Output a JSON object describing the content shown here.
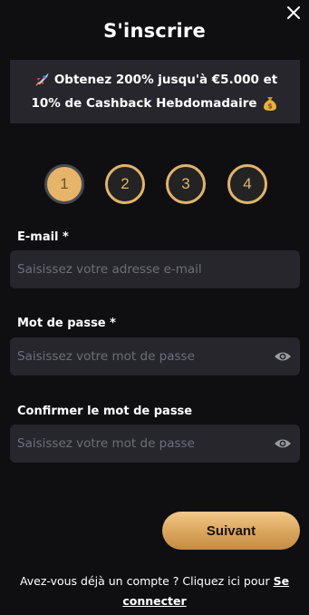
{
  "modal": {
    "title": "S'inscrire",
    "close_icon": "close-icon"
  },
  "promo": {
    "line1": "Obtenez 200% jusqu'à €5.000 et",
    "line2": "10% de Cashback Hebdomadaire",
    "line1_icon": "rocket-icon",
    "line2_icon": "money-bag-icon"
  },
  "steps": [
    {
      "label": "1",
      "active": true
    },
    {
      "label": "2",
      "active": false
    },
    {
      "label": "3",
      "active": false
    },
    {
      "label": "4",
      "active": false
    }
  ],
  "form": {
    "email": {
      "label": "E-mail *",
      "placeholder": "Saisissez votre adresse e-mail",
      "value": ""
    },
    "password": {
      "label": "Mot de passe *",
      "placeholder": "Saisissez votre mot de passe",
      "value": ""
    },
    "confirm": {
      "label": "Confirmer le mot de passe",
      "placeholder": "Saisissez votre mot de passe",
      "value": ""
    }
  },
  "actions": {
    "next_label": "Suivant"
  },
  "footer": {
    "text": "Avez-vous déjà un compte ? Cliquez ici pour ",
    "link": "Se connecter"
  },
  "colors": {
    "background": "#0f0f11",
    "surface": "#26262c",
    "accent": "#e0b46b"
  }
}
